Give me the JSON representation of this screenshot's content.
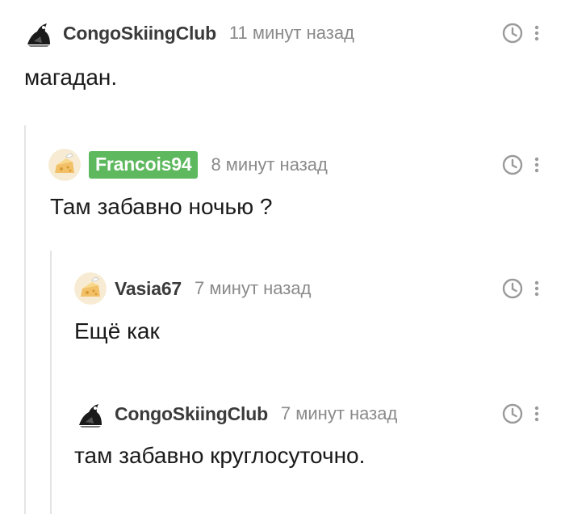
{
  "comments": [
    {
      "username": "CongoSkiingClub",
      "time": "11 минут назад",
      "text": "магадан.",
      "avatar_icon": "bird-avatar-icon",
      "badge": false
    },
    {
      "username": "Francois94",
      "time": "8 минут назад",
      "text": "Там забавно ночью ?",
      "avatar_icon": "cheese-avatar-icon",
      "badge": true,
      "badge_color": "#5eb85e"
    },
    {
      "username": "Vasia67",
      "time": "7 минут назад",
      "text": "Ещё как",
      "avatar_icon": "cheese-avatar-icon",
      "badge": false
    },
    {
      "username": "CongoSkiingClub",
      "time": "7 минут назад",
      "text": "там забавно круглосуточно.",
      "avatar_icon": "bird-avatar-icon",
      "badge": false
    }
  ],
  "icons": {
    "clock": "clock-icon",
    "more": "more-vertical-icon"
  },
  "colors": {
    "username": "#3a3a3a",
    "time": "#8a8a8a",
    "text": "#1a1a1a",
    "thread_line": "#e4e4e4",
    "badge": "#5eb85e"
  }
}
